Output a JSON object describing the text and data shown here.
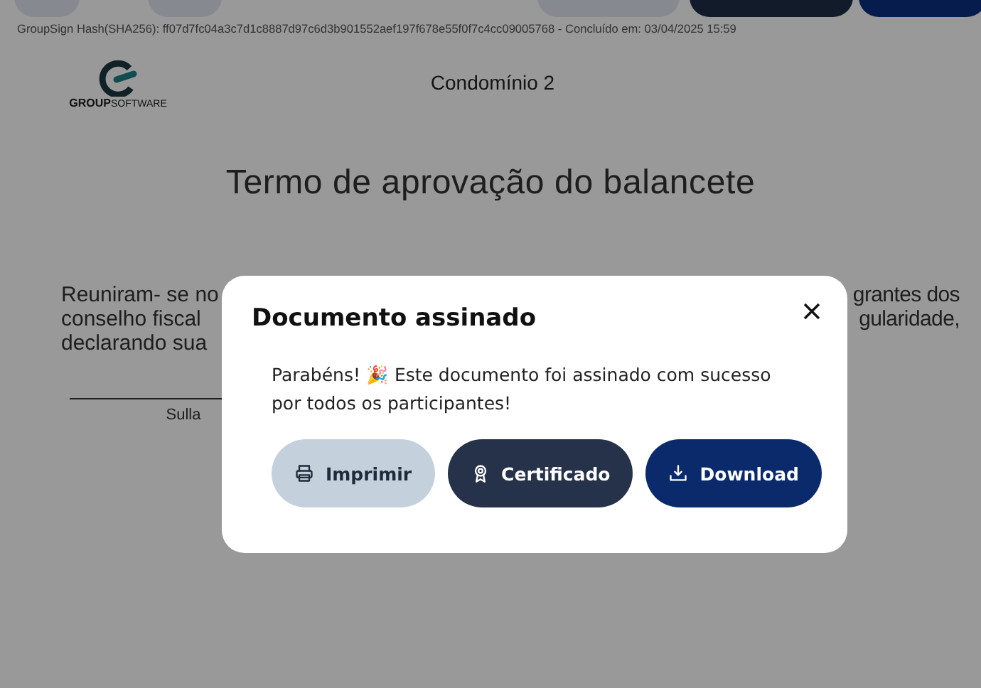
{
  "toolbar": {
    "buttons": [
      {
        "kind": "light"
      },
      {
        "kind": "light"
      },
      {
        "kind": "light"
      },
      {
        "kind": "dark"
      },
      {
        "kind": "primary"
      }
    ]
  },
  "document": {
    "hash_line": "GroupSign Hash(SHA256): ff07d7fc04a3c7d1c8887d97c6d3b901552aef197f678e55f0f7c4cc09005768 - Concluído em: 03/04/2025 15:59",
    "logo": {
      "brand": "GROUP",
      "suffix": "SOFTWARE"
    },
    "header": "Condomínio 2",
    "title": "Termo de aprovação do balancete",
    "lines": [
      {
        "left": "Reuniram- se no",
        "right": "grantes dos"
      },
      {
        "left": "conselho fiscal",
        "right": "gularidade,"
      },
      {
        "left": "declarando sua"
      }
    ],
    "signature": "Sulla"
  },
  "dialog": {
    "title": "Documento assinado",
    "message": "Parabéns! 🎉 Este documento foi assinado com sucesso por todos os participantes!",
    "buttons": [
      {
        "kind": "print",
        "label": "Imprimir"
      },
      {
        "kind": "certificate",
        "label": "Certificado"
      },
      {
        "kind": "download",
        "label": "Download"
      }
    ]
  }
}
